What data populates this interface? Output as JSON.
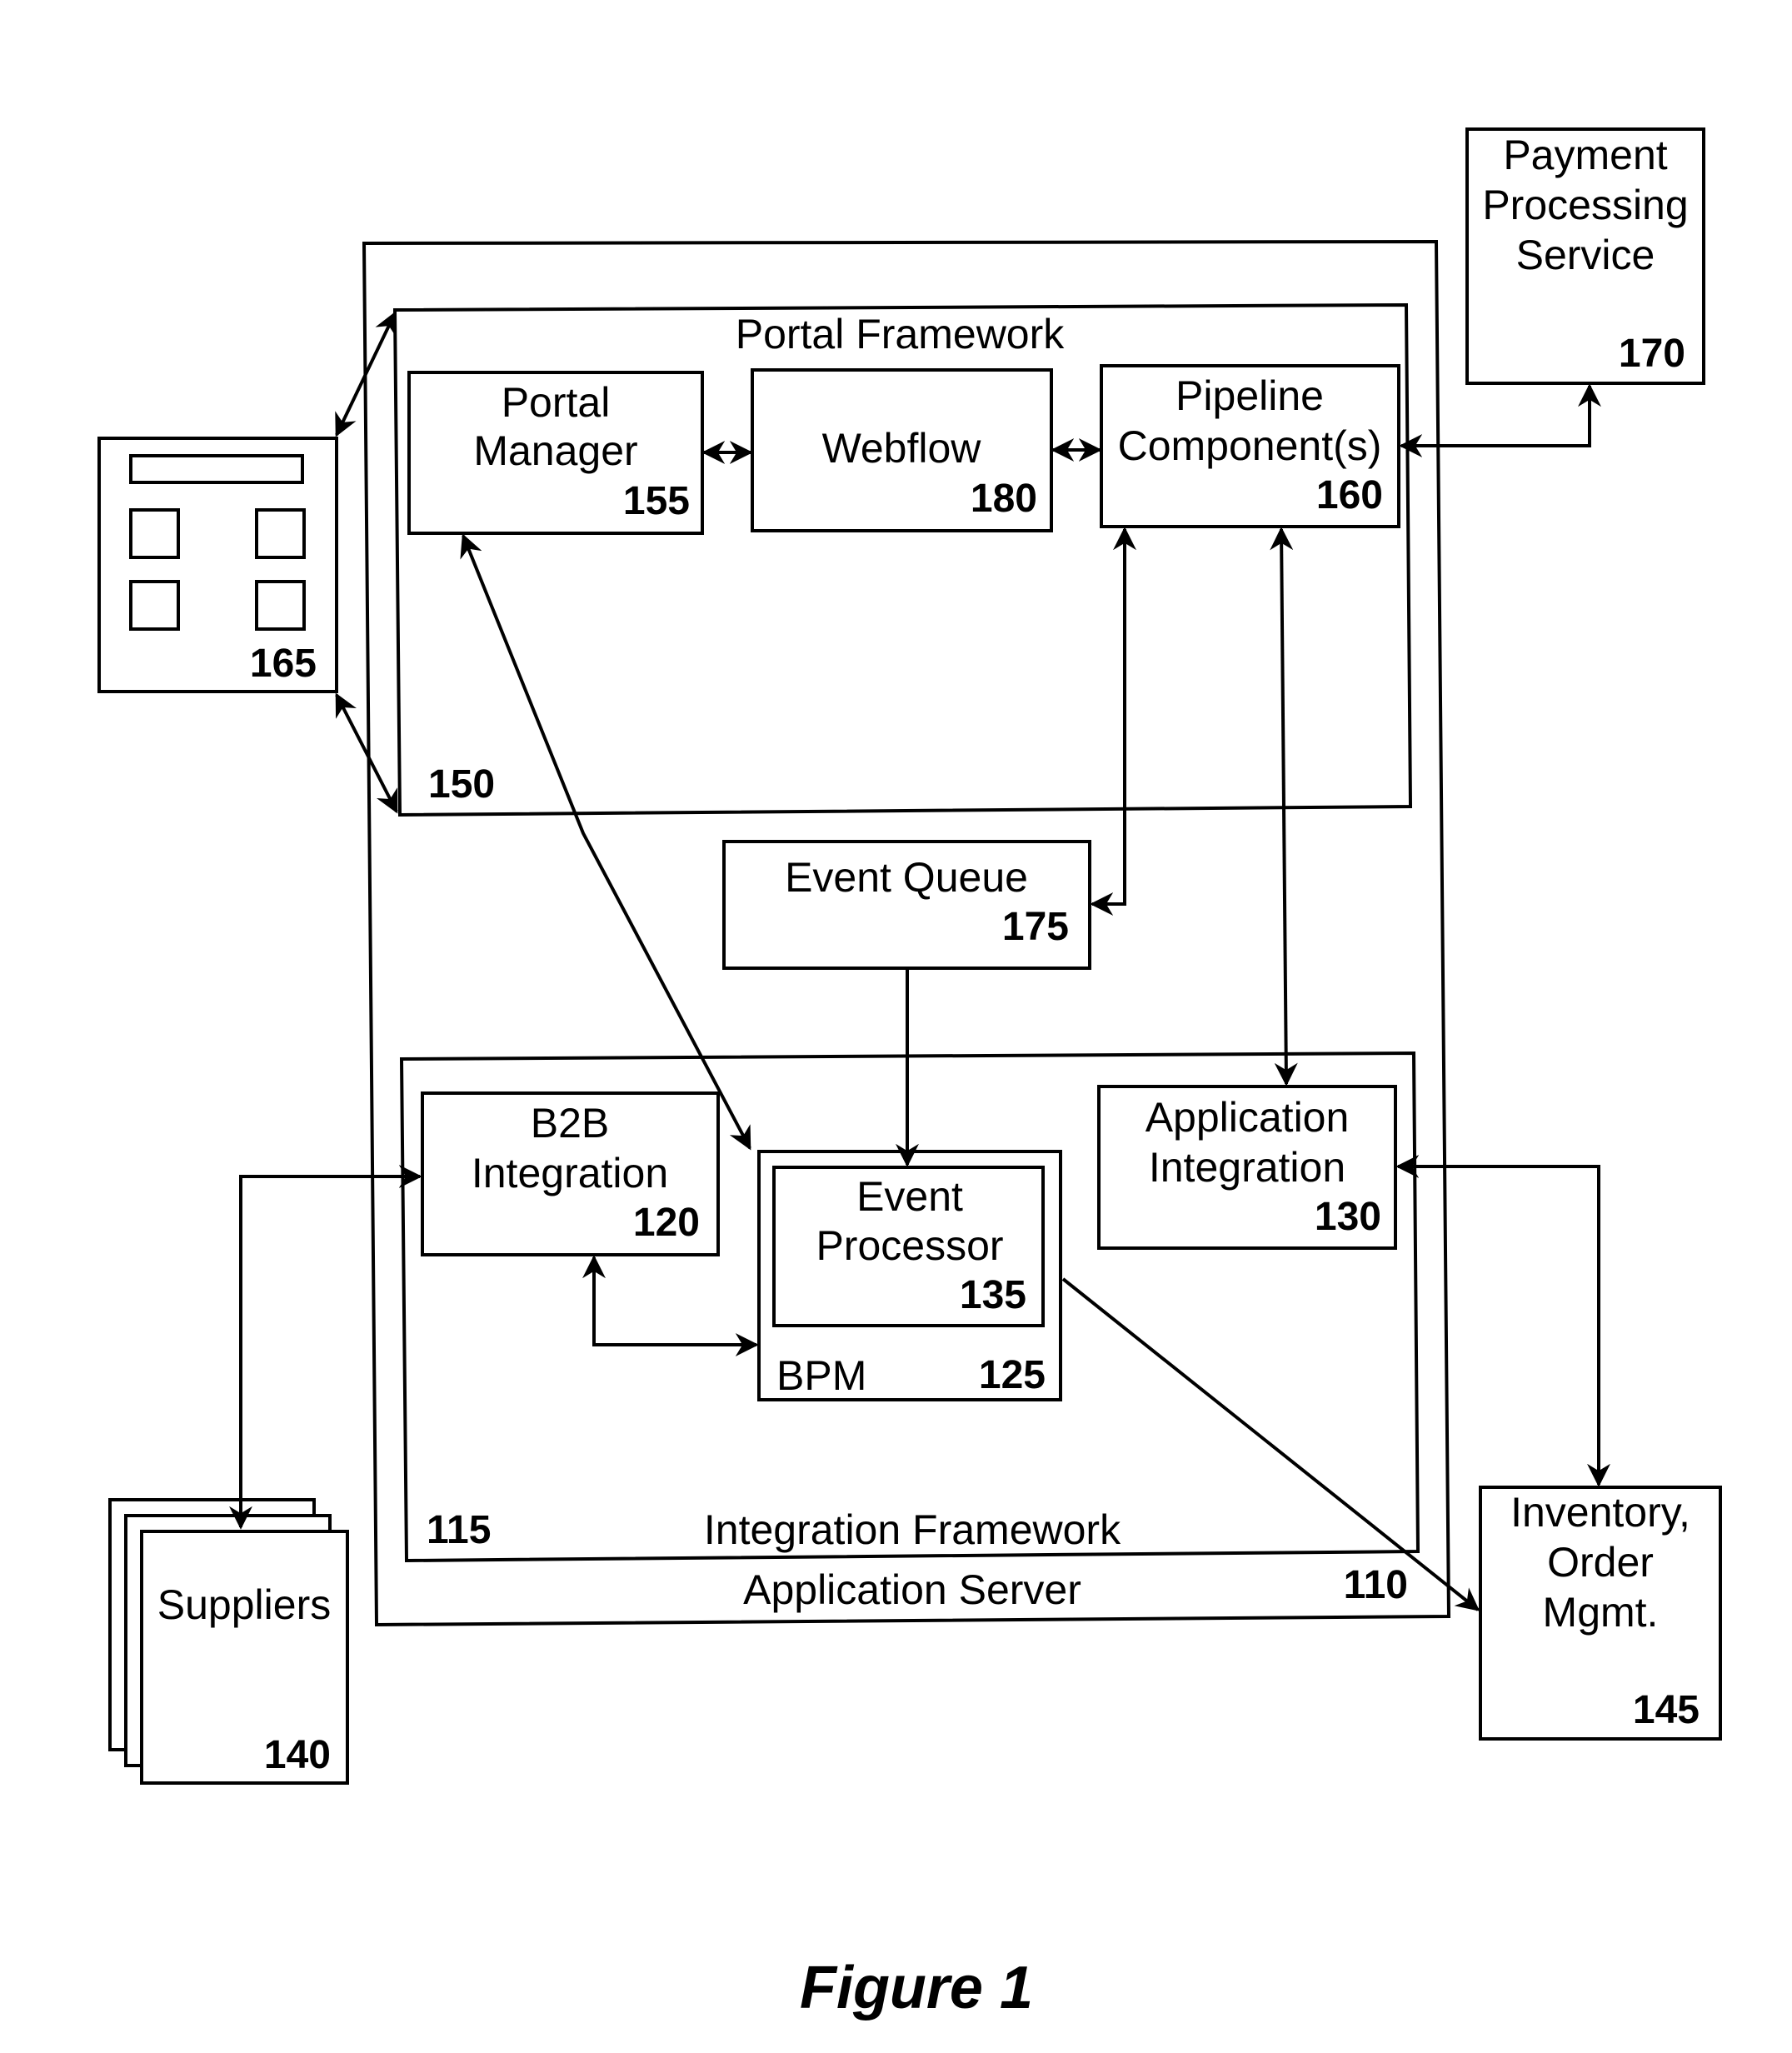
{
  "figure_caption": "Figure 1",
  "components": {
    "application_server": {
      "label": "Application Server",
      "ref": "110"
    },
    "portal_framework": {
      "label": "Portal Framework",
      "ref": "150"
    },
    "portal_manager": {
      "label_lines": [
        "Portal",
        "Manager"
      ],
      "ref": "155"
    },
    "webflow": {
      "label": "Webflow",
      "ref": "180"
    },
    "pipeline_components": {
      "label_lines": [
        "Pipeline",
        "Component(s)"
      ],
      "ref": "160"
    },
    "payment_processing_service": {
      "label_lines": [
        "Payment",
        "Processing",
        "Service"
      ],
      "ref": "170"
    },
    "client_device": {
      "ref": "165"
    },
    "event_queue": {
      "label": "Event Queue",
      "ref": "175"
    },
    "integration_framework": {
      "label": "Integration Framework",
      "ref": "115"
    },
    "b2b_integration": {
      "label_lines": [
        "B2B",
        "Integration"
      ],
      "ref": "120"
    },
    "bpm": {
      "label": "BPM",
      "ref": "125"
    },
    "event_processor": {
      "label_lines": [
        "Event",
        "Processor"
      ],
      "ref": "135"
    },
    "application_integration": {
      "label_lines": [
        "Application",
        "Integration"
      ],
      "ref": "130"
    },
    "suppliers": {
      "label": "Suppliers",
      "ref": "140"
    },
    "inventory_order_mgmt": {
      "label_lines": [
        "Inventory,",
        "Order",
        "Mgmt."
      ],
      "ref": "145"
    }
  },
  "connections": [
    {
      "from": "client_device",
      "to": "portal_framework",
      "type": "bidirectional"
    },
    {
      "from": "portal_manager",
      "to": "webflow",
      "type": "bidirectional"
    },
    {
      "from": "webflow",
      "to": "pipeline_components",
      "type": "bidirectional"
    },
    {
      "from": "pipeline_components",
      "to": "payment_processing_service",
      "type": "bidirectional"
    },
    {
      "from": "pipeline_components",
      "to": "event_queue",
      "type": "bidirectional"
    },
    {
      "from": "pipeline_components",
      "to": "application_integration",
      "type": "bidirectional"
    },
    {
      "from": "portal_manager",
      "to": "bpm",
      "type": "bidirectional"
    },
    {
      "from": "event_queue",
      "to": "event_processor",
      "type": "directed"
    },
    {
      "from": "b2b_integration",
      "to": "bpm",
      "type": "bidirectional"
    },
    {
      "from": "suppliers",
      "to": "b2b_integration",
      "type": "bidirectional"
    },
    {
      "from": "application_integration",
      "to": "inventory_order_mgmt",
      "type": "bidirectional"
    },
    {
      "from": "event_processor",
      "to": "inventory_order_mgmt",
      "type": "directed"
    }
  ]
}
